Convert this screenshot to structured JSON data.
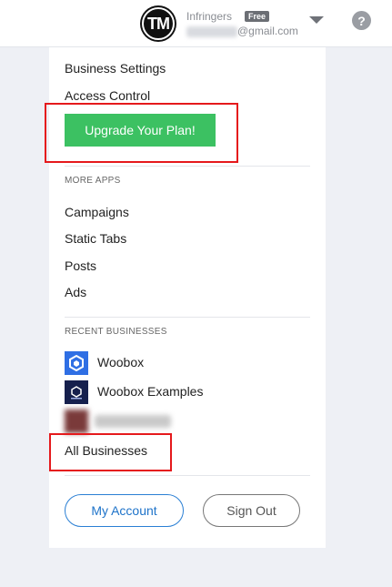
{
  "header": {
    "avatar_initials": "TM",
    "account_name": "Infringers",
    "plan_badge": "Free",
    "email_domain": "@gmail.com",
    "help_symbol": "?"
  },
  "menu": {
    "business_settings": "Business Settings",
    "access_control": "Access Control",
    "upgrade_label": "Upgrade Your Plan!"
  },
  "more_apps": {
    "heading": "MORE APPS",
    "items": [
      "Campaigns",
      "Static Tabs",
      "Posts",
      "Ads"
    ]
  },
  "recent_businesses": {
    "heading": "RECENT BUSINESSES",
    "items": [
      "Woobox",
      "Woobox Examples"
    ],
    "all_label": "All Businesses"
  },
  "footer": {
    "my_account": "My Account",
    "sign_out": "Sign Out"
  },
  "colors": {
    "upgrade_green": "#3cc162",
    "link_blue": "#1e73c9",
    "highlight_red": "#e5191c",
    "background": "#eef0f5"
  }
}
